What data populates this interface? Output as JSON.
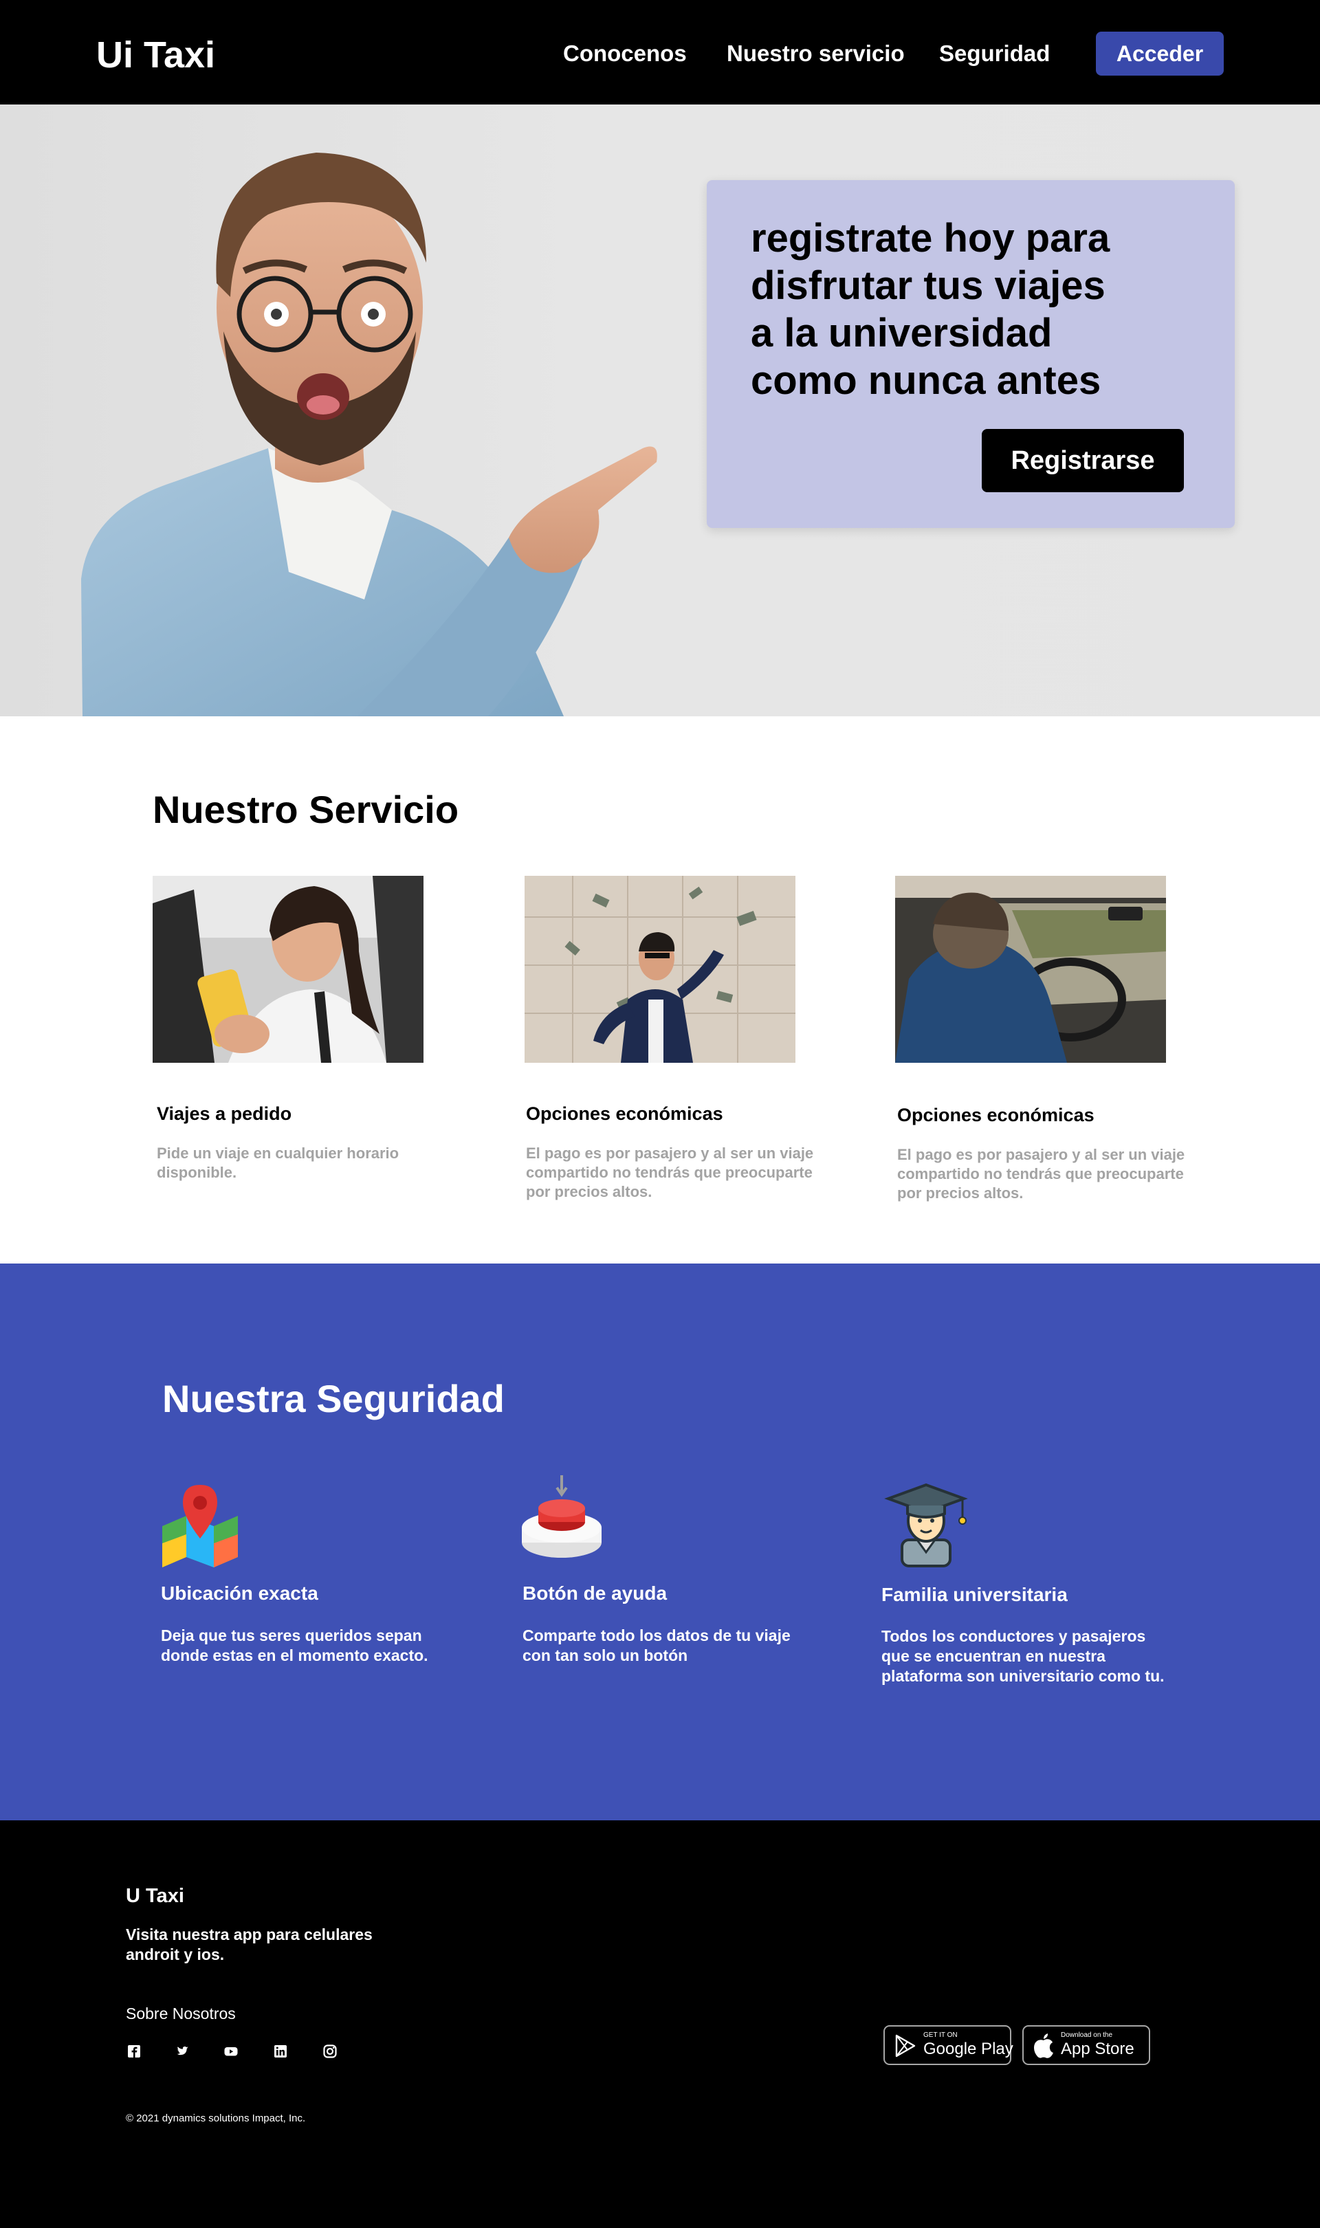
{
  "header": {
    "logo": "Ui Taxi",
    "nav": [
      "Conocenos",
      "Nuestro servicio",
      "Seguridad"
    ],
    "login_label": "Acceder"
  },
  "hero": {
    "lines": [
      "registrate hoy para",
      "disfrutar tus viajes",
      "a la universidad",
      "como nunca antes"
    ],
    "cta_label": "Registrarse"
  },
  "servicio": {
    "title": "Nuestro Servicio",
    "items": [
      {
        "name": "Viajes a pedido",
        "desc": "Pide un viaje en cualquier horario disponible."
      },
      {
        "name": "Opciones económicas",
        "desc": "El pago es por pasajero y al ser un viaje compartido no tendrás que preocuparte por precios altos."
      },
      {
        "name": "Opciones económicas",
        "desc": "El pago es por pasajero y al ser un viaje compartido no tendrás que preocuparte por precios altos."
      }
    ]
  },
  "seguridad": {
    "title": "Nuestra Seguridad",
    "items": [
      {
        "name": "Ubicación exacta",
        "desc": "Deja que tus seres queridos sepan donde estas en el momento exacto.",
        "icon": "map-pin-icon"
      },
      {
        "name": "Botón de ayuda",
        "desc": "Comparte todo los datos de tu viaje con tan solo un botón",
        "icon": "panic-button-icon"
      },
      {
        "name": "Familia universitaria",
        "desc": "Todos los conductores y pasajeros que se encuentran en nuestra plataforma son universitario como tu.",
        "icon": "graduate-icon"
      }
    ]
  },
  "footer": {
    "brand": "U Taxi",
    "tagline": "Visita nuestra app para celulares androit y ios.",
    "about": "Sobre Nosotros",
    "social": [
      "facebook-icon",
      "twitter-icon",
      "youtube-icon",
      "linkedin-icon",
      "instagram-icon"
    ],
    "copyright": "© 2021 dynamics solutions Impact, Inc.",
    "stores": {
      "google_small": "GET IT ON",
      "google_big": "Google Play",
      "apple_small": "Download on the",
      "apple_big": "App Store"
    }
  },
  "colors": {
    "accent": "#3f51b5",
    "button": "#3949ab",
    "hero_card": "#c3c5e5",
    "muted_text": "#a3a3a3"
  }
}
